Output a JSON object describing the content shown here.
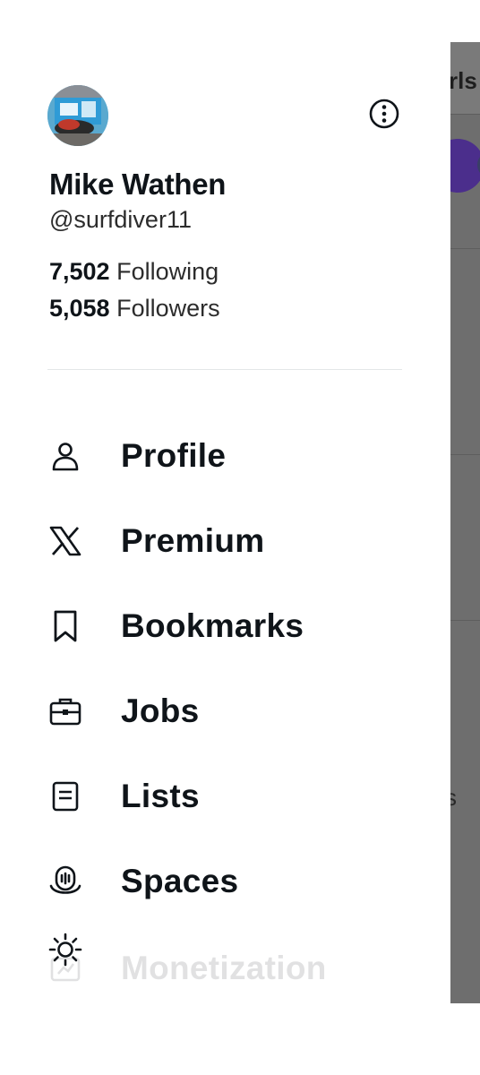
{
  "background": {
    "title_fragment": "rls",
    "side_fragment": "s"
  },
  "drawer": {
    "profile": {
      "display_name": "Mike Wathen",
      "handle": "@surfdiver11",
      "following_count": "7,502",
      "following_label": "Following",
      "followers_count": "5,058",
      "followers_label": "Followers"
    },
    "nav": [
      {
        "label": "Profile",
        "icon": "person-icon"
      },
      {
        "label": "Premium",
        "icon": "x-logo-icon"
      },
      {
        "label": "Bookmarks",
        "icon": "bookmark-icon"
      },
      {
        "label": "Jobs",
        "icon": "briefcase-icon"
      },
      {
        "label": "Lists",
        "icon": "list-icon"
      },
      {
        "label": "Spaces",
        "icon": "microphone-icon"
      },
      {
        "label": "Monetization",
        "icon": "monetization-icon"
      }
    ],
    "bottom_icon": "sun-icon"
  },
  "colors": {
    "text": "#0f1419",
    "divider": "#e3e6e8",
    "overlay": "#6e6e6e"
  }
}
